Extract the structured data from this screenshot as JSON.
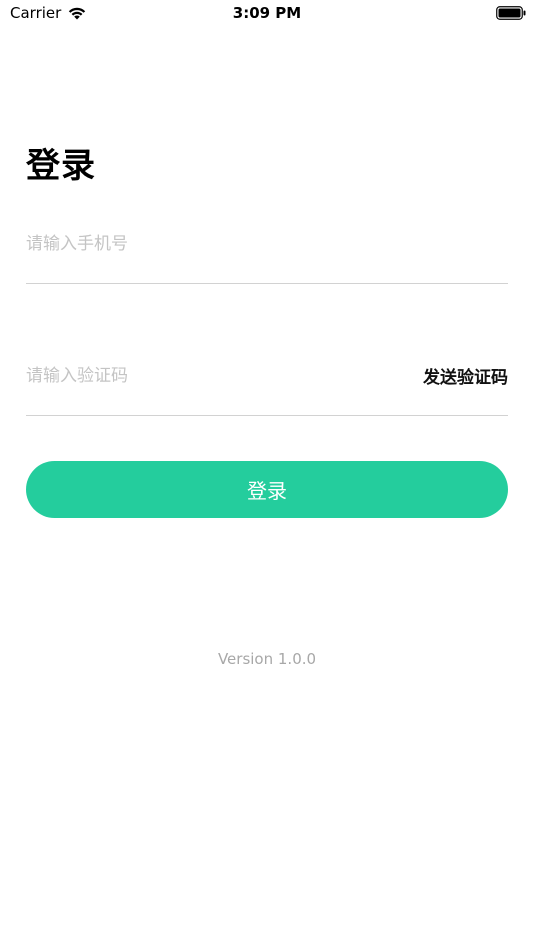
{
  "status_bar": {
    "carrier": "Carrier",
    "time": "3:09 PM",
    "wifi_icon": "wifi-icon",
    "battery_icon": "battery-icon"
  },
  "login": {
    "title": "登录",
    "phone_placeholder": "请输入手机号",
    "phone_value": "",
    "code_placeholder": "请输入验证码",
    "code_value": "",
    "send_code_label": "发送验证码",
    "submit_label": "登录"
  },
  "footer": {
    "version": "Version 1.0.0"
  },
  "colors": {
    "accent": "#24cd9d",
    "placeholder": "#c4c4c4",
    "divider": "#d2d2d2",
    "version_text": "#a8a8a8"
  }
}
